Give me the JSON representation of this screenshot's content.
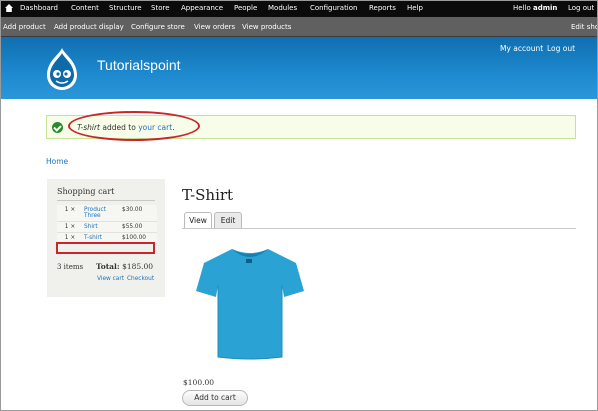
{
  "toolbar": {
    "items": [
      "Dashboard",
      "Content",
      "Structure",
      "Store",
      "Appearance",
      "People",
      "Modules",
      "Configuration",
      "Reports",
      "Help"
    ],
    "greeting_prefix": "Hello",
    "username": "admin",
    "logout": "Log out"
  },
  "shortcuts": {
    "items": [
      "Add product",
      "Add product display",
      "Configure store",
      "View orders",
      "View products"
    ],
    "edit": "Edit shortcuts"
  },
  "header": {
    "site_name": "Tutorialspoint",
    "my_account": "My account",
    "logout": "Log out"
  },
  "message": {
    "product": "T-shirt",
    "middle": "added to",
    "link": "your cart",
    "end": "."
  },
  "breadcrumb": "Home",
  "cart": {
    "title": "Shopping cart",
    "rows": [
      {
        "qty": "1 ×",
        "title_line1": "Product",
        "title_line2": "Three",
        "price": "$30.00"
      },
      {
        "qty": "1 ×",
        "title_line1": "Shirt",
        "title_line2": "",
        "price": "$55.00"
      },
      {
        "qty": "1 ×",
        "title_line1": "T-shirt",
        "title_line2": "",
        "price": "$100.00"
      }
    ],
    "count": "3 items",
    "total_label": "Total:",
    "total_value": "$185.00",
    "view_cart": "View cart",
    "checkout": "Checkout"
  },
  "product": {
    "title": "T-Shirt",
    "tabs": [
      "View",
      "Edit"
    ],
    "price": "$100.00",
    "add_to_cart": "Add to cart"
  },
  "colors": {
    "toolbar_bg": "#0b0b0b",
    "shortcuts_bg": "#606060",
    "header_blue": "#1e89cf",
    "link": "#1e73be",
    "highlight": "#c8262c",
    "tshirt": "#2aa3d4"
  }
}
